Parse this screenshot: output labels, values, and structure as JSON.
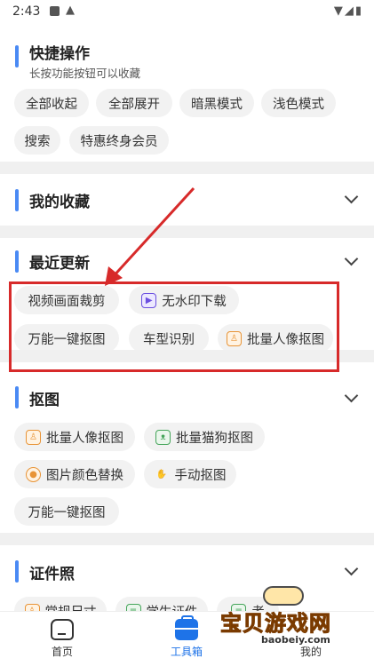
{
  "status_bar": {
    "time": "2:43",
    "icons_right": "▼◢▮"
  },
  "quick_actions": {
    "title": "快捷操作",
    "subtitle": "长按功能按钮可以收藏",
    "chips": [
      "全部收起",
      "全部展开",
      "暗黑模式",
      "浅色模式",
      "搜索",
      "特惠终身会员"
    ]
  },
  "favorites": {
    "title": "我的收藏"
  },
  "recent_updates": {
    "title": "最近更新",
    "chips": [
      {
        "label": "视频画面裁剪",
        "icon": ""
      },
      {
        "label": "无水印下载",
        "icon": "play-icon"
      },
      {
        "label": "万能一键抠图",
        "icon": ""
      },
      {
        "label": "车型识别",
        "icon": ""
      },
      {
        "label": "批量人像抠图",
        "icon": "portrait-icon"
      }
    ]
  },
  "cutout": {
    "title": "抠图",
    "chips": [
      {
        "label": "批量人像抠图",
        "icon": "portrait-icon"
      },
      {
        "label": "批量猫狗抠图",
        "icon": "cat-icon"
      },
      {
        "label": "图片颜色替换",
        "icon": "palette-icon"
      },
      {
        "label": "手动抠图",
        "icon": "hand-icon"
      },
      {
        "label": "万能一键抠图",
        "icon": ""
      }
    ]
  },
  "id_photo": {
    "title": "证件照",
    "chips": [
      {
        "label": "常规尺寸",
        "icon": "portrait-icon"
      },
      {
        "label": "学生证件",
        "icon": "student-icon"
      },
      {
        "label": "考",
        "icon": "exam-icon"
      }
    ]
  },
  "bottom_nav": {
    "items": [
      {
        "label": "首页",
        "active": false
      },
      {
        "label": "工具箱",
        "active": true
      },
      {
        "label": "我的",
        "active": false
      }
    ]
  },
  "watermark": {
    "text": "宝贝游戏网",
    "url": "baobeiy.com"
  },
  "colors": {
    "accent": "#1e73e8",
    "section_bar": "#4a8af4",
    "highlight_box": "#d72a2a"
  }
}
